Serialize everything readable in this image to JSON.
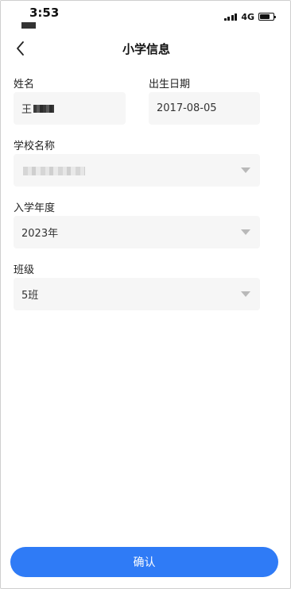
{
  "status_bar": {
    "time": "3:53",
    "network": "4G"
  },
  "nav": {
    "title": "小学信息",
    "back_icon": "chevron-left-icon"
  },
  "form": {
    "name": {
      "label": "姓名",
      "value": "王"
    },
    "birth_date": {
      "label": "出生日期",
      "value": "2017-08-05"
    },
    "school": {
      "label": "学校名称",
      "value": ""
    },
    "enroll_year": {
      "label": "入学年度",
      "value": "2023年"
    },
    "class": {
      "label": "班级",
      "value": "5班"
    }
  },
  "confirm_label": "确认",
  "colors": {
    "accent": "#2f7bf6",
    "field_bg": "#f6f6f6",
    "caret": "#b9b9b9"
  }
}
